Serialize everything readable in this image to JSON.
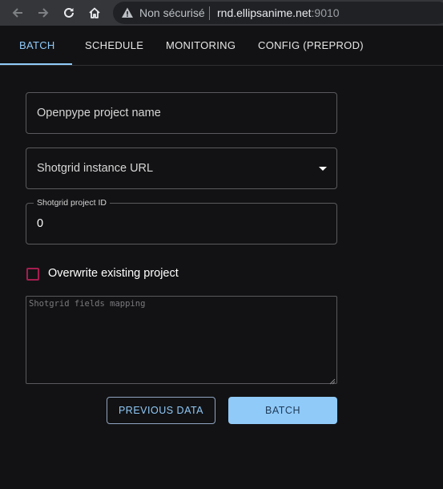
{
  "browser": {
    "back_icon": "arrow-left-icon",
    "forward_icon": "arrow-right-icon",
    "reload_icon": "reload-icon",
    "home_icon": "home-icon",
    "security_icon": "warning-triangle-icon",
    "security_text": "Non sécurisé",
    "url_host": "rnd.ellipsanime.net",
    "url_port": ":9010"
  },
  "tabs": [
    {
      "label": "BATCH",
      "active": true
    },
    {
      "label": "SCHEDULE",
      "active": false
    },
    {
      "label": "MONITORING",
      "active": false
    },
    {
      "label": "CONFIG (PREPROD)",
      "active": false
    }
  ],
  "form": {
    "project_name_placeholder": "Openpype project name",
    "instance_url_placeholder": "Shotgrid instance URL",
    "project_id_label": "Shotgrid project ID",
    "project_id_value": "0",
    "overwrite_label": "Overwrite existing project",
    "overwrite_checked": false,
    "fields_mapping_placeholder": "Shotgrid fields mapping",
    "previous_button": "PREVIOUS DATA",
    "batch_button": "BATCH"
  },
  "colors": {
    "accent": "#90caf9",
    "checkbox_border": "#a51d4f",
    "background": "#121214"
  }
}
